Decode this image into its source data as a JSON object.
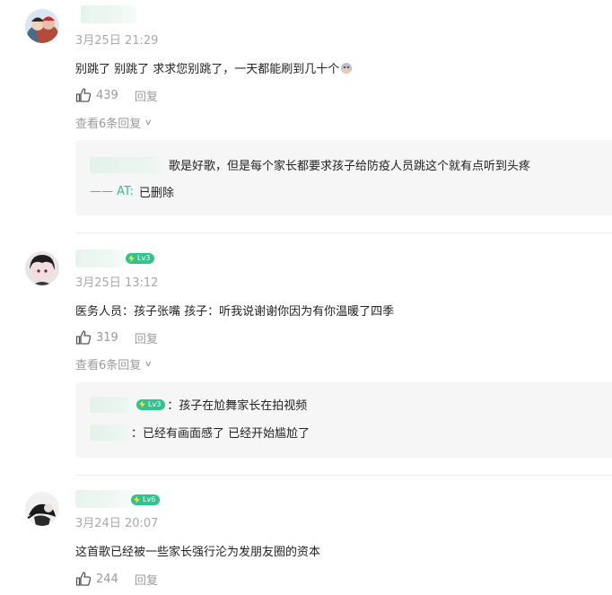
{
  "comments": [
    {
      "time": "3月25日 21:29",
      "text": "别跳了 别跳了 求求您别跳了，一天都能刷到几十个",
      "likes": "439",
      "reply_label": "回复",
      "view_replies": "查看6条回复",
      "replies": [
        {
          "text": "歌是好歌，但是每个家长都要求孩子给防疫人员跳这个就有点听到头疼"
        },
        {
          "at_prefix": "—— AT:",
          "text": "已删除"
        }
      ]
    },
    {
      "time": "3月25日 13:12",
      "level": "Lv3",
      "text": "医务人员：孩子张嘴 孩子：听我说谢谢你因为有你温暖了四季",
      "likes": "319",
      "reply_label": "回复",
      "view_replies": "查看6条回复",
      "replies": [
        {
          "level": "Lv3",
          "text": "：孩子在尬舞家长在拍视频"
        },
        {
          "text": "：已经有画面感了 已经开始尴尬了"
        }
      ]
    },
    {
      "time": "3月24日 20:07",
      "level": "Lv6",
      "text": "这首歌已经被一些家长强行沦为发朋友圈的资本",
      "likes": "244",
      "reply_label": "回复"
    }
  ],
  "colors": {
    "accent_green": "#2fc48d",
    "muted_text": "#9a9a9a",
    "reply_background": "#f6f6f6"
  },
  "icons": [
    "thumbs-up-icon",
    "chevron-down-icon",
    "level-badge-icon"
  ]
}
